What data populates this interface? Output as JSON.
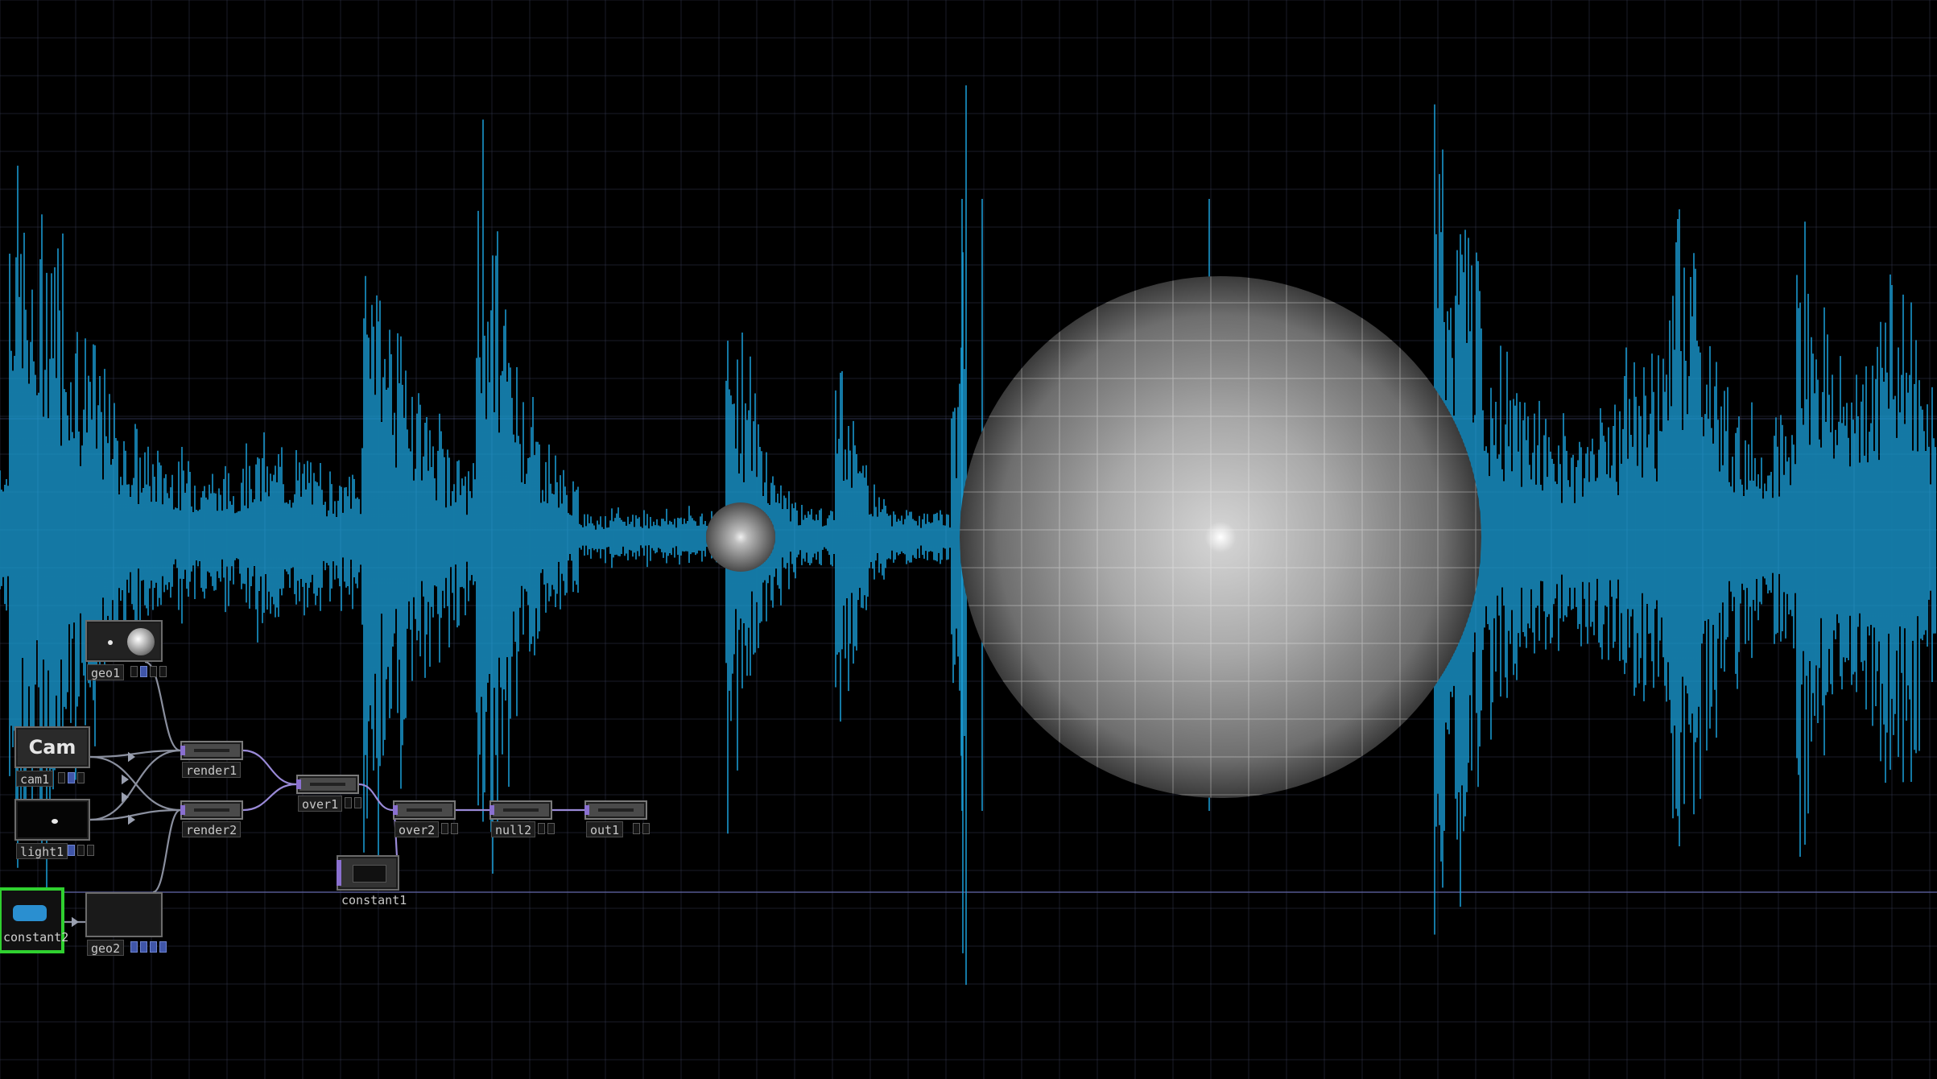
{
  "colors": {
    "background": "#000000",
    "waveform": "#1a9fd8",
    "grid": "#3a3f58",
    "node_border": "#6b6b6b",
    "selected_outline": "#2fd02f",
    "input_port": "#8a70d0"
  },
  "nodes": [
    {
      "id": "geo1",
      "label": "geo1",
      "icon": "geo-sphere-thumbnail"
    },
    {
      "id": "cam1",
      "label": "cam1",
      "icon": "camera-thumbnail",
      "thumb_text": "Cam"
    },
    {
      "id": "light1",
      "label": "light1",
      "icon": "light-thumbnail"
    },
    {
      "id": "constant2",
      "label": "constant2",
      "icon": "constant-thumbnail",
      "selected": true
    },
    {
      "id": "geo2",
      "label": "geo2",
      "icon": "geo-thumbnail"
    },
    {
      "id": "render1",
      "label": "render1",
      "icon": "render-thumbnail"
    },
    {
      "id": "render2",
      "label": "render2",
      "icon": "render-thumbnail"
    },
    {
      "id": "over1",
      "label": "over1",
      "icon": "over-thumbnail"
    },
    {
      "id": "over2",
      "label": "over2",
      "icon": "over-thumbnail"
    },
    {
      "id": "null2",
      "label": "null2",
      "icon": "null-thumbnail"
    },
    {
      "id": "out1",
      "label": "out1",
      "icon": "out-thumbnail"
    },
    {
      "id": "constant1",
      "label": "constant1",
      "icon": "constant-thumbnail"
    }
  ],
  "connections": [
    [
      "geo1",
      "render1"
    ],
    [
      "cam1",
      "render1"
    ],
    [
      "cam1",
      "render2"
    ],
    [
      "light1",
      "render1"
    ],
    [
      "light1",
      "render2"
    ],
    [
      "geo2",
      "render2"
    ],
    [
      "constant2",
      "geo2"
    ],
    [
      "render1",
      "over1"
    ],
    [
      "render2",
      "over1"
    ],
    [
      "over1",
      "over2"
    ],
    [
      "constant1",
      "over2"
    ],
    [
      "over2",
      "null2"
    ],
    [
      "null2",
      "out1"
    ]
  ]
}
